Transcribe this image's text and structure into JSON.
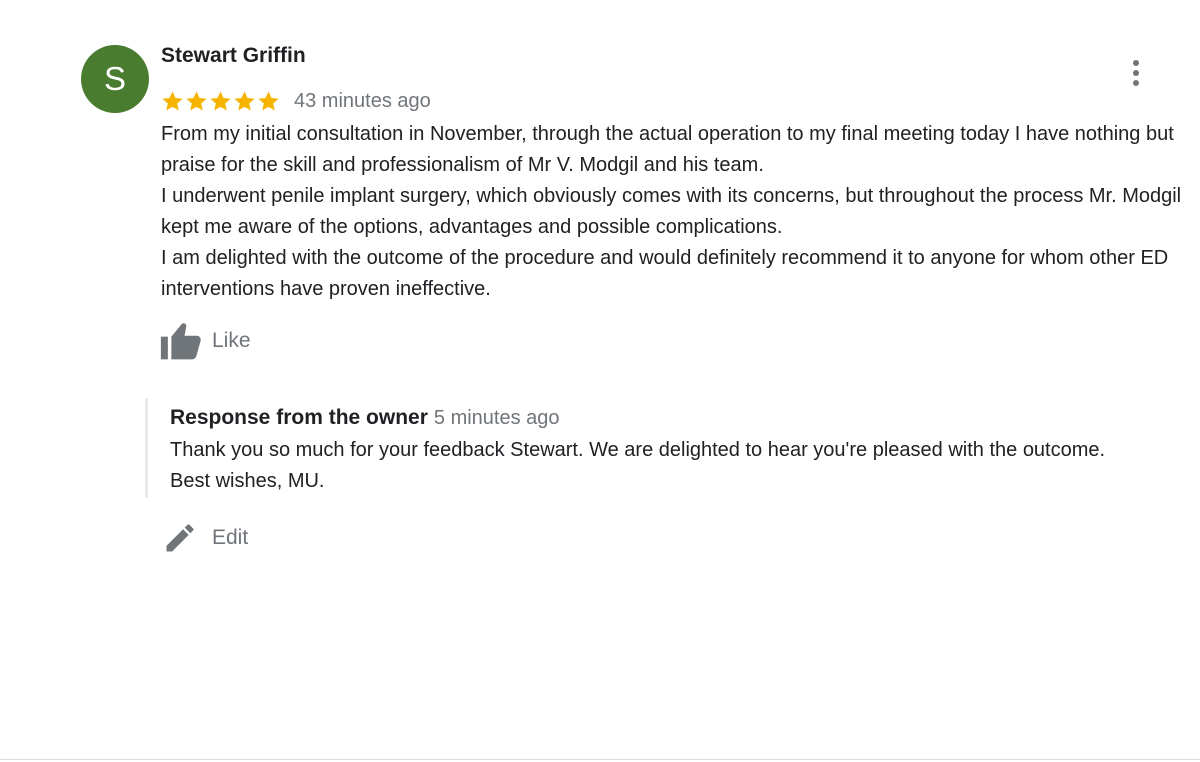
{
  "review": {
    "avatar_initial": "S",
    "avatar_color": "#4a7c2f",
    "reviewer_name": "Stewart Griffin",
    "rating": 5,
    "rating_max": 5,
    "star_color": "#f4b400",
    "time": "43 minutes ago",
    "paragraphs": [
      "From my initial consultation in November, through the actual operation to my final meeting today I have nothing but praise for the skill and professionalism of Mr V. Modgil and his team.",
      "I underwent penile implant surgery, which obviously comes with its concerns, but throughout the process Mr. Modgil kept me aware of the options, advantages and possible complications.",
      "I am delighted with the outcome of the procedure and would definitely recommend it to anyone for whom other ED interventions have proven ineffective."
    ],
    "more_icon": "more-vert-icon",
    "like_icon": "thumb-up-icon",
    "like_label": "Like"
  },
  "owner_response": {
    "title": "Response from the owner",
    "time": "5 minutes ago",
    "text": "Thank you so much for your feedback Stewart. We are delighted to hear you're pleased with the outcome. Best wishes, MU."
  },
  "edit": {
    "icon": "pencil-icon",
    "label": "Edit"
  }
}
